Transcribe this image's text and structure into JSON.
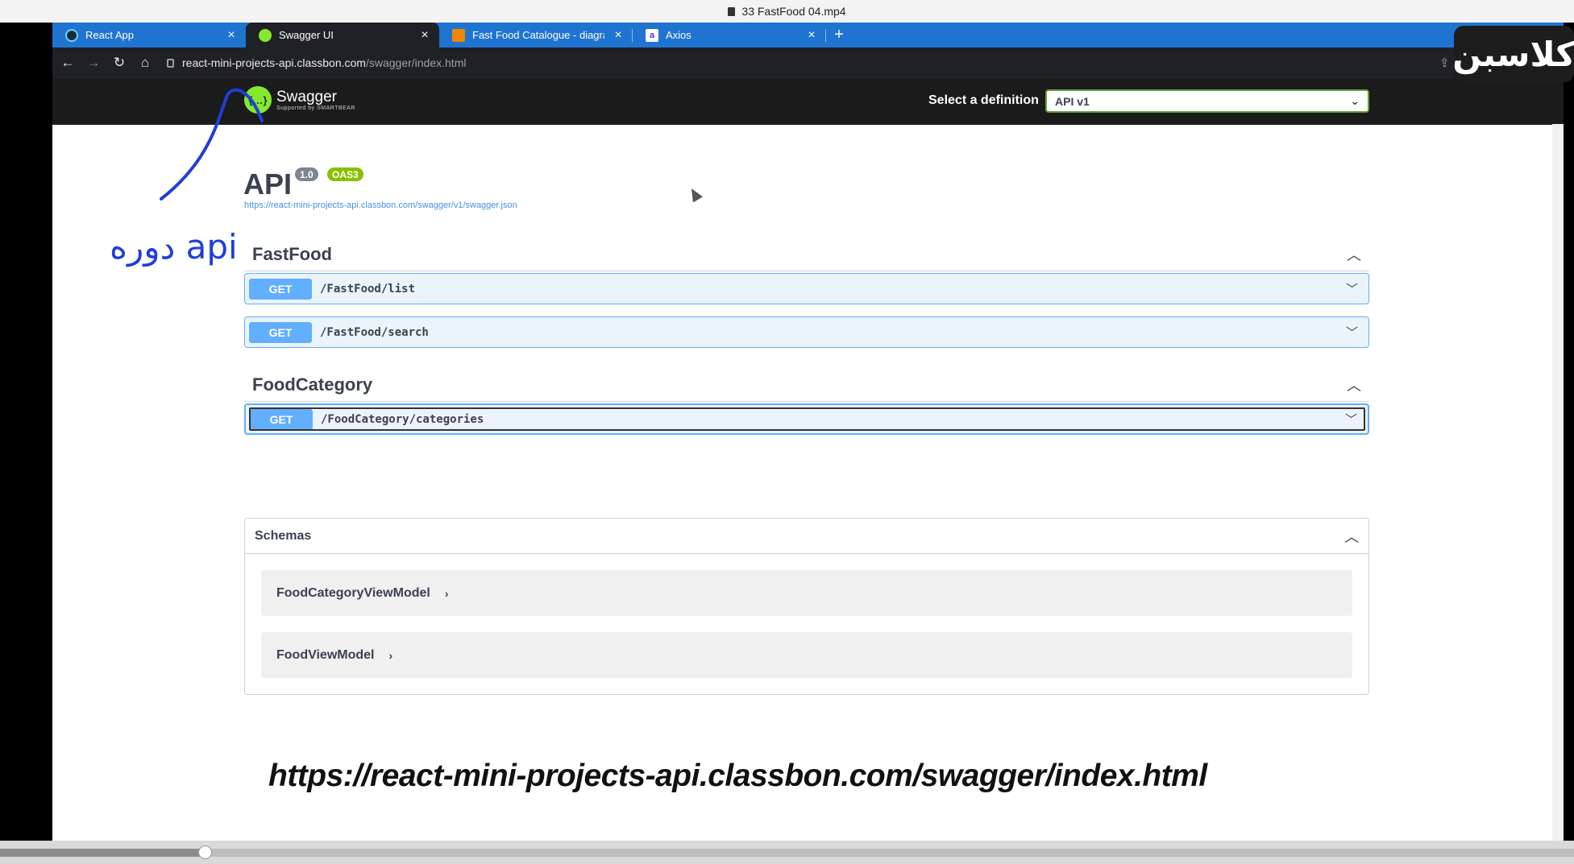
{
  "player": {
    "title": "33 FastFood 04.mp4",
    "progress_fraction": 0.13
  },
  "browser": {
    "tabs": [
      {
        "title": "React App",
        "icon": "react-icon"
      },
      {
        "title": "Swagger UI",
        "icon": "swagger-icon"
      },
      {
        "title": "Fast Food Catalogue - diagrams.",
        "icon": "drawio-icon"
      },
      {
        "title": "Axios",
        "icon": "axios-icon",
        "fav_letter": "a"
      }
    ],
    "active_tab": 1,
    "url_host": "react-mini-projects-api.classbon.com",
    "url_path": "/swagger/index.html"
  },
  "swagger": {
    "logo_name": "Swagger",
    "logo_sub": "Supported by SMARTBEAR",
    "definition_label": "Select a definition",
    "definition_value": "API v1",
    "api_title": "API",
    "version_badge": "1.0",
    "oas_badge": "OAS3",
    "spec_url": "https://react-mini-projects-api.classbon.com/swagger/v1/swagger.json",
    "tags": [
      {
        "name": "FastFood",
        "operations": [
          {
            "method": "GET",
            "path": "/FastFood/list"
          },
          {
            "method": "GET",
            "path": "/FastFood/search"
          }
        ]
      },
      {
        "name": "FoodCategory",
        "operations": [
          {
            "method": "GET",
            "path": "/FoodCategory/categories"
          }
        ]
      }
    ],
    "schemas_title": "Schemas",
    "models": [
      "FoodCategoryViewModel",
      "FoodViewModel"
    ]
  },
  "overlay": {
    "note": "دوره api",
    "big_url": "https://react-mini-projects-api.classbon.com/swagger/index.html",
    "watermark": "کلاسبن"
  },
  "colors": {
    "get_method": "#61affe",
    "get_bg": "#ebf3fb",
    "oas_badge": "#89bf04",
    "tab_bar": "#1e74d0",
    "annotation": "#1f3fd9"
  }
}
